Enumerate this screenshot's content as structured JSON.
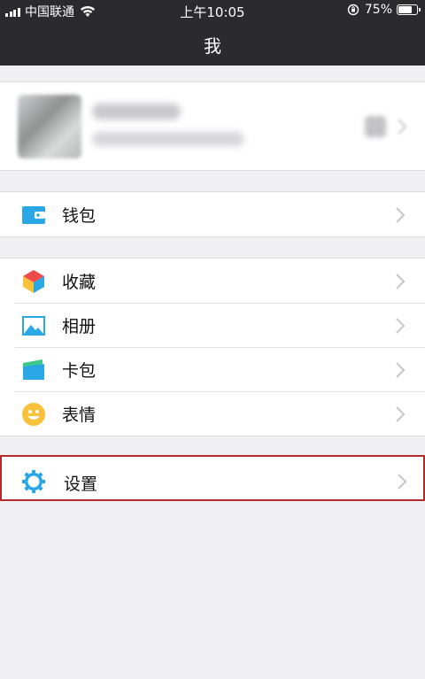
{
  "status_bar": {
    "carrier": "中国联通",
    "time": "上午10:05",
    "battery_percent": "75%",
    "battery_level": 0.75
  },
  "nav": {
    "title": "我"
  },
  "menu": {
    "wallet": {
      "label": "钱包",
      "icon": "wallet-icon"
    },
    "favorites": {
      "label": "收藏",
      "icon": "cube-icon"
    },
    "album": {
      "label": "相册",
      "icon": "picture-icon"
    },
    "cards": {
      "label": "卡包",
      "icon": "card-icon"
    },
    "stickers": {
      "label": "表情",
      "icon": "smiley-icon"
    },
    "settings": {
      "label": "设置",
      "icon": "gear-icon"
    }
  },
  "colors": {
    "nav_bg": "#2b2b2f",
    "page_bg": "#efeff4",
    "highlight_border": "#b52a2a",
    "chevron": "#c7c7cc"
  }
}
